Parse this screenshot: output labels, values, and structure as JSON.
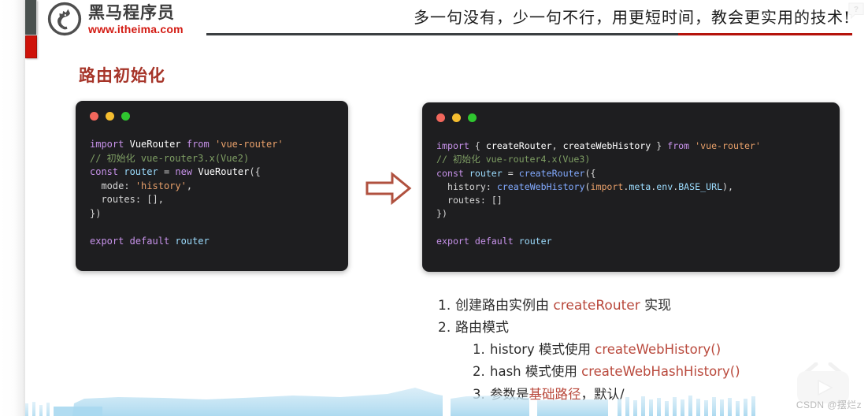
{
  "header": {
    "logo_cn": "黑马程序员",
    "logo_url": "www.itheima.com",
    "tagline": "多一句没有，少一句不行，用更短时间，教会更实用的技术!",
    "help_icon": "question-bubble-icon"
  },
  "slide": {
    "title": "路由初始化",
    "arrow_icon": "right-arrow-icon"
  },
  "code_left": {
    "title_dots": [
      "red",
      "yellow",
      "green"
    ],
    "lines": [
      "import VueRouter from 'vue-router'",
      "// 初始化 vue-router3.x(Vue2)",
      "const router = new VueRouter({",
      "  mode: 'history',",
      "  routes: [],",
      "})",
      "",
      "export default router"
    ]
  },
  "code_right": {
    "title_dots": [
      "red",
      "yellow",
      "green"
    ],
    "lines": [
      "import { createRouter, createWebHistory } from 'vue-router'",
      "// 初始化 vue-router4.x(Vue3)",
      "const router = createRouter({",
      "  history: createWebHistory(import.meta.env.BASE_URL),",
      "  routes: []",
      "})",
      "",
      "export default router"
    ]
  },
  "notes": [
    {
      "num": "1.",
      "parts": [
        {
          "t": "创建路由实例由  ",
          "style": "plain"
        },
        {
          "t": "createRouter",
          "style": "red"
        },
        {
          "t": " 实现",
          "style": "plain"
        }
      ],
      "sub": []
    },
    {
      "num": "2.",
      "parts": [
        {
          "t": "路由模式",
          "style": "plain"
        }
      ],
      "sub": [
        {
          "num": "1.",
          "parts": [
            {
              "t": "history 模式使用  ",
              "style": "plain"
            },
            {
              "t": "createWebHistory()",
              "style": "red"
            }
          ]
        },
        {
          "num": "2.",
          "parts": [
            {
              "t": "hash 模式使用 ",
              "style": "plain"
            },
            {
              "t": "createWebHashHistory()",
              "style": "red"
            }
          ]
        },
        {
          "num": "3.",
          "parts": [
            {
              "t": "参数是",
              "style": "plain"
            },
            {
              "t": "基础路径",
              "style": "red"
            },
            {
              "t": "，默认/",
              "style": "plain"
            }
          ]
        }
      ]
    }
  ],
  "watermark": {
    "text": "CSDN @摆烂z",
    "icon": "tv-play-icon"
  },
  "colors": {
    "brand_red": "#d31a12",
    "title_red": "#a63428",
    "accent_gray": "#4a514f",
    "accent_red": "#ce1209",
    "code_bg": "#1e1e20",
    "note_red": "#b9493c",
    "skyline_blue": "#b8dff0"
  }
}
